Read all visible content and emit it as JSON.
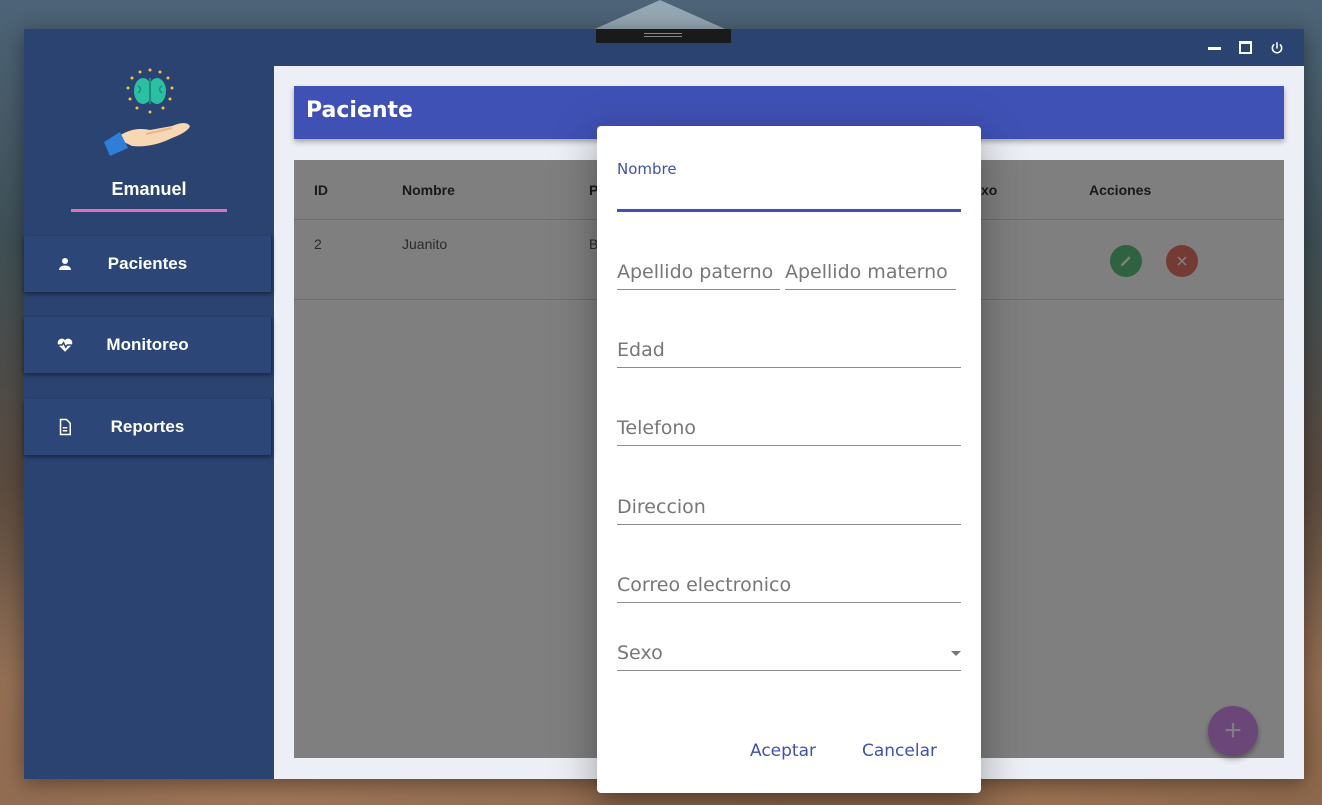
{
  "window": {
    "controls": {
      "minimize": "minimize-icon",
      "maximize": "maximize-icon",
      "power": "power-icon"
    }
  },
  "sidebar": {
    "user_name": "Emanuel",
    "items": [
      {
        "label": "Pacientes",
        "icon": "person-icon"
      },
      {
        "label": "Monitoreo",
        "icon": "heartbeat-icon"
      },
      {
        "label": "Reportes",
        "icon": "document-icon"
      }
    ]
  },
  "main": {
    "title": "Paciente",
    "table": {
      "headers": [
        "ID",
        "Nombre",
        "P",
        "xo",
        "Acciones"
      ],
      "rows": [
        {
          "id": "2",
          "nombre": "Juanito",
          "partial": "B"
        }
      ]
    }
  },
  "dialog": {
    "fields": {
      "nombre": "Nombre",
      "apellido_paterno": "Apellido paterno",
      "apellido_materno": "Apellido materno",
      "edad": "Edad",
      "telefono": "Telefono",
      "direccion": "Direccion",
      "correo": "Correo electronico",
      "sexo": "Sexo"
    },
    "buttons": {
      "accept": "Aceptar",
      "cancel": "Cancelar"
    }
  },
  "colors": {
    "primary": "#3f51b5",
    "sidebar": "#2b4371",
    "accent_underline": "#e36fb6",
    "fab": "#d78cf3",
    "edit": "#5ec57f",
    "delete": "#e8776a"
  }
}
